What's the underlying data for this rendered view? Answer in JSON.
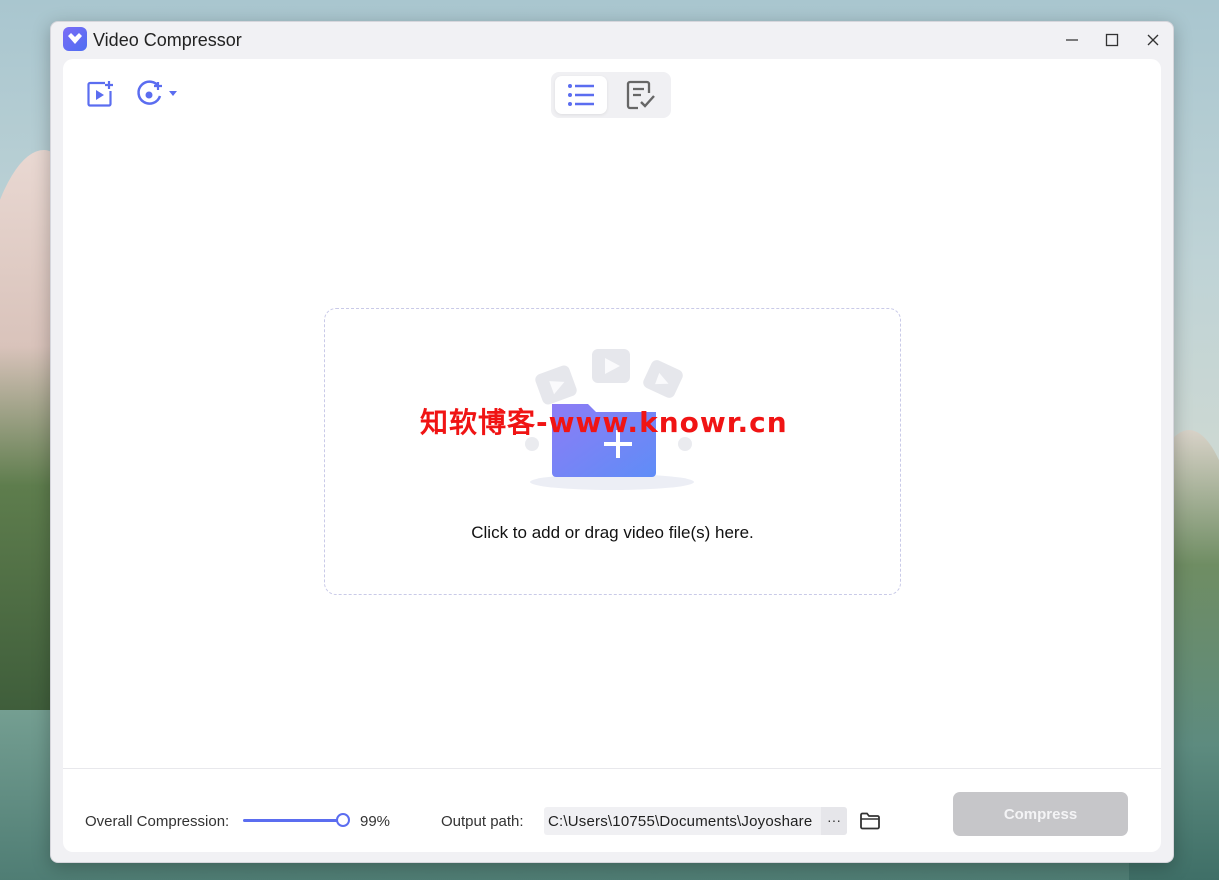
{
  "window": {
    "title": "Video Compressor"
  },
  "toolbar": {
    "icons": [
      "add-video-icon",
      "settings-icon",
      "list-view-icon",
      "task-view-icon"
    ]
  },
  "dropzone": {
    "text": "Click to add or drag video file(s) here."
  },
  "watermark": {
    "text": "知软博客-www.knowr.cn"
  },
  "footer": {
    "compression_label": "Overall Compression:",
    "compression_value": "99%",
    "compression_level": 0.99,
    "output_label": "Output path:",
    "output_path": "C:\\Users\\10755\\Documents\\Joyoshare",
    "more_label": "···",
    "compress_label": "Compress"
  },
  "colors": {
    "accent": "#5b6df0",
    "watermark": "#f01414",
    "button_disabled": "#c6c6c9"
  }
}
